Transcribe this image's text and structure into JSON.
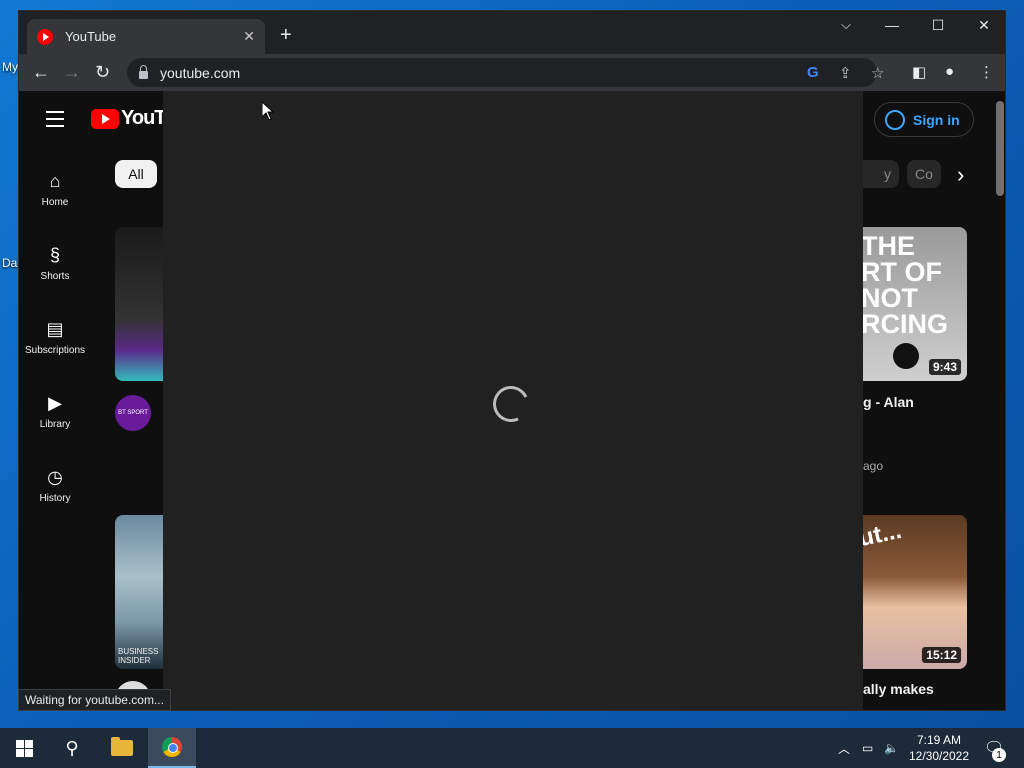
{
  "desktop": {
    "icon_label_1": "My",
    "icon_label_2": "Da"
  },
  "browser": {
    "tab_title": "YouTube",
    "tab_close": "✕",
    "new_tab": "+",
    "url": "youtube.com",
    "status_text": "Waiting for youtube.com...",
    "controls": {
      "dropdown": "⌵",
      "minimize": "—",
      "maximize": "☐",
      "close": "✕"
    },
    "nav": {
      "back": "←",
      "forward": "→",
      "reload": "↻"
    }
  },
  "youtube": {
    "logo_text": "YouTu",
    "sign_in": "Sign in",
    "chip_all": "All",
    "chip_partial_1": "y",
    "chip_partial_2": "Co",
    "chip_next": "›",
    "guide": [
      {
        "label": "Home",
        "icon": "home-icon"
      },
      {
        "label": "Shorts",
        "icon": "shorts-icon"
      },
      {
        "label": "Subscriptions",
        "icon": "subscriptions-icon"
      },
      {
        "label": "Library",
        "icon": "library-icon"
      },
      {
        "label": "History",
        "icon": "history-icon"
      }
    ],
    "channel_avatar": "BT SPORT",
    "thumb_text_1": "THE\nRT OF\nNOT\nRCING",
    "video_1": {
      "duration": "9:43",
      "title": "g - Alan",
      "meta": "ago"
    },
    "video_2": {
      "duration": "15:12",
      "title": "ally makes",
      "thumb_text": "ut..."
    },
    "thumb_left_text": "BUSINESS\nINSIDER"
  },
  "taskbar": {
    "time": "7:19 AM",
    "date": "12/30/2022",
    "notification_count": "1"
  }
}
